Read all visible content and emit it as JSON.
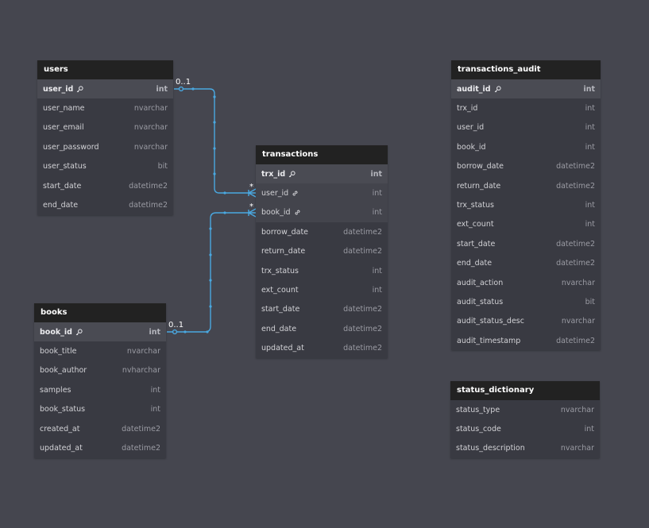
{
  "colors": {
    "background": "#45464f",
    "header": "#222222",
    "table_body": "#393a42",
    "pk_row": "#4a4b53",
    "relationship_line": "#4aa8e0"
  },
  "tables": {
    "users": {
      "title": "users",
      "columns": [
        {
          "name": "user_id",
          "type": "int",
          "pk": true
        },
        {
          "name": "user_name",
          "type": "nvarchar"
        },
        {
          "name": "user_email",
          "type": "nvarchar"
        },
        {
          "name": "user_password",
          "type": "nvarchar"
        },
        {
          "name": "user_status",
          "type": "bit"
        },
        {
          "name": "start_date",
          "type": "datetime2"
        },
        {
          "name": "end_date",
          "type": "datetime2"
        }
      ]
    },
    "books": {
      "title": "books",
      "columns": [
        {
          "name": "book_id",
          "type": "int",
          "pk": true
        },
        {
          "name": "book_title",
          "type": "nvarchar"
        },
        {
          "name": "book_author",
          "type": "nvharchar"
        },
        {
          "name": "samples",
          "type": "int"
        },
        {
          "name": "book_status",
          "type": "int"
        },
        {
          "name": "created_at",
          "type": "datetime2"
        },
        {
          "name": "updated_at",
          "type": "datetime2"
        }
      ]
    },
    "transactions": {
      "title": "transactions",
      "columns": [
        {
          "name": "trx_id",
          "type": "int",
          "pk": true
        },
        {
          "name": "user_id",
          "type": "int",
          "fk": true
        },
        {
          "name": "book_id",
          "type": "int",
          "fk": true
        },
        {
          "name": "borrow_date",
          "type": "datetime2"
        },
        {
          "name": "return_date",
          "type": "datetime2"
        },
        {
          "name": "trx_status",
          "type": "int"
        },
        {
          "name": "ext_count",
          "type": "int"
        },
        {
          "name": "start_date",
          "type": "datetime2"
        },
        {
          "name": "end_date",
          "type": "datetime2"
        },
        {
          "name": "updated_at",
          "type": "datetime2"
        }
      ]
    },
    "transactions_audit": {
      "title": "transactions_audit",
      "columns": [
        {
          "name": "audit_id",
          "type": "int",
          "pk": true
        },
        {
          "name": "trx_id",
          "type": "int"
        },
        {
          "name": "user_id",
          "type": "int"
        },
        {
          "name": "book_id",
          "type": "int"
        },
        {
          "name": "borrow_date",
          "type": "datetime2"
        },
        {
          "name": "return_date",
          "type": "datetime2"
        },
        {
          "name": "trx_status",
          "type": "int"
        },
        {
          "name": "ext_count",
          "type": "int"
        },
        {
          "name": "start_date",
          "type": "datetime2"
        },
        {
          "name": "end_date",
          "type": "datetime2"
        },
        {
          "name": "audit_action",
          "type": "nvarchar"
        },
        {
          "name": "audit_status",
          "type": "bit"
        },
        {
          "name": "audit_status_desc",
          "type": "nvarchar"
        },
        {
          "name": "audit_timestamp",
          "type": "datetime2"
        }
      ]
    },
    "status_dictionary": {
      "title": "status_dictionary",
      "columns": [
        {
          "name": "status_type",
          "type": "nvarchar"
        },
        {
          "name": "status_code",
          "type": "int"
        },
        {
          "name": "status_description",
          "type": "nvarchar"
        }
      ]
    }
  },
  "relationships": [
    {
      "from": "users.user_id",
      "to": "transactions.user_id",
      "from_label": "0..1",
      "to_label": "*"
    },
    {
      "from": "books.book_id",
      "to": "transactions.book_id",
      "from_label": "0..1",
      "to_label": "*"
    }
  ]
}
